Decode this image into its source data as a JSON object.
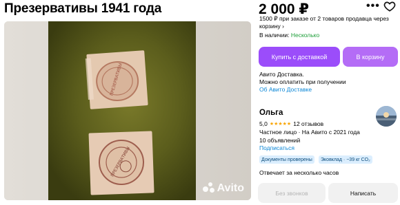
{
  "listing": {
    "title": "Презервативы 1941 года"
  },
  "photo": {
    "watermark": "Avito"
  },
  "pricing": {
    "price": "2 000 ₽",
    "promo_text": "1500 ₽ при заказе от 2 товаров продавца через корзину ›",
    "stock_label": "В наличии:",
    "stock_value": "Несколько"
  },
  "actions": {
    "more_icon": "more-icon",
    "favorite_icon": "heart-icon",
    "buy_label": "Купить с доставкой",
    "cart_label": "В корзину"
  },
  "delivery": {
    "line1": "Авито Доставка.",
    "line2": "Можно оплатить при получении",
    "link": "Об Авито Доставке"
  },
  "seller": {
    "name": "Ольга",
    "rating": "5,0",
    "reviews": "12 отзывов",
    "type": "Частное лицо · На Авито с 2021 года",
    "ads": "10 объявлений",
    "subscribe": "Подписаться",
    "badges": [
      "Документы проверены",
      "Эковклад · −39 кг CO₂"
    ],
    "responds": "Отвечает за несколько часов"
  },
  "contact": {
    "no_calls": "Без звонков",
    "write": "Написать"
  },
  "colors": {
    "accent": "#9b4dfa",
    "link": "#0a86d6",
    "stock": "#1d9e39",
    "star": "#f9a400"
  }
}
